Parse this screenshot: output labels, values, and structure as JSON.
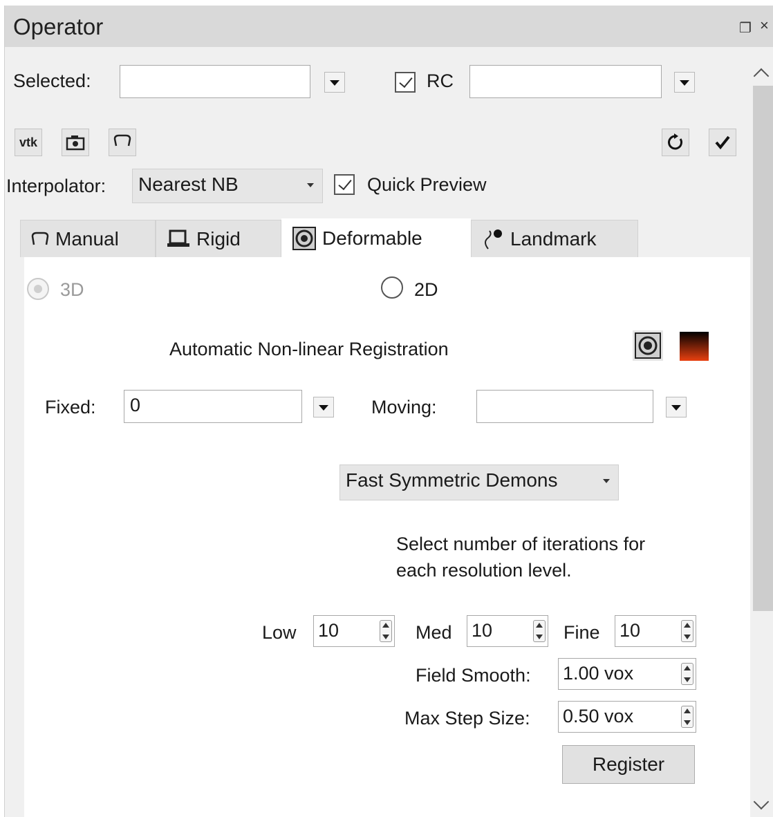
{
  "window": {
    "title": "Operator",
    "float_icon": "float-icon",
    "close_icon": "close-icon"
  },
  "selection": {
    "selected_label": "Selected:",
    "selected_value": "",
    "roi_checked": true,
    "roi_label": "RC",
    "roi_value": ""
  },
  "toolbar": {
    "buttons": [
      {
        "name": "vtk-button",
        "text": "vtk"
      },
      {
        "name": "camera-icon",
        "text": ""
      },
      {
        "name": "manual-icon",
        "text": ""
      }
    ],
    "reset_icon": "reset-icon",
    "apply_icon": "check-icon"
  },
  "interpolator": {
    "label": "Interpolator:",
    "value": "Nearest NB",
    "quick_preview_checked": true,
    "quick_preview_label": "Quick Preview"
  },
  "tabs": [
    {
      "label": "Manual",
      "icon": "hand-icon",
      "active": false
    },
    {
      "label": "Rigid",
      "icon": "rigid-icon",
      "active": false
    },
    {
      "label": "Deformable",
      "icon": "deformable-icon",
      "active": true
    },
    {
      "label": "Landmark",
      "icon": "landmark-icon",
      "active": false
    }
  ],
  "deformable": {
    "mode_3d_label": "3D",
    "mode_2d_label": "2D",
    "section_title": "Automatic Non-linear Registration",
    "fixed_label": "Fixed:",
    "fixed_value": "0",
    "moving_label": "Moving:",
    "moving_value": "",
    "algorithm": "Fast Symmetric Demons",
    "iterations_hint_line1": "Select number of iterations for",
    "iterations_hint_line2": "each resolution level.",
    "low_label": "Low",
    "low_value": "10",
    "med_label": "Med",
    "med_value": "10",
    "fine_label": "Fine",
    "fine_value": "10",
    "field_smooth_label": "Field Smooth:",
    "field_smooth_value": "1.00 vox",
    "max_step_label": "Max Step Size:",
    "max_step_value": "0.50 vox",
    "register_label": "Register"
  },
  "colors": {
    "panel_bg": "#f0f0f0",
    "title_bg": "#d9d9d9",
    "content_bg": "#ffffff",
    "colormap_top": "#000000",
    "colormap_bottom": "#e84010"
  }
}
